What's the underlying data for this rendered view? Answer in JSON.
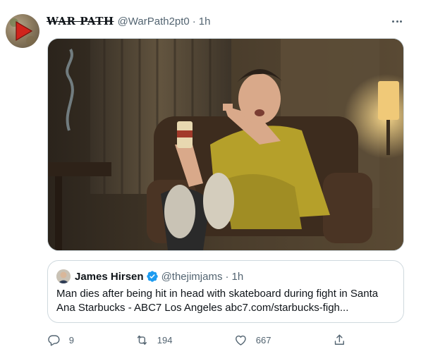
{
  "author": {
    "display_name": "WAR PATH",
    "handle": "@WarPath2pt0",
    "separator": "·",
    "time": "1h",
    "avatar_icon": "red-play-arrow-icon"
  },
  "more_icon": "more-horizontal-icon",
  "media": {
    "alt_icon": "photo-icon"
  },
  "quoted_tweet": {
    "display_name": "James Hirsen",
    "verified": true,
    "handle": "@thejimjams",
    "separator": "·",
    "time": "1h",
    "text": "Man dies after being hit in head with skateboard during fight in Santa Ana Starbucks - ABC7 Los Angeles abc7.com/starbucks-figh..."
  },
  "actions": {
    "reply": {
      "icon": "reply-icon",
      "count": "9"
    },
    "retweet": {
      "icon": "retweet-icon",
      "count": "194"
    },
    "like": {
      "icon": "heart-icon",
      "count": "667"
    },
    "share": {
      "icon": "share-icon"
    }
  },
  "colors": {
    "text": "#0f1419",
    "secondary": "#536471",
    "border": "#cfd9de",
    "verified": "#1d9bf0",
    "avatar_arrow": "#d1241c"
  }
}
